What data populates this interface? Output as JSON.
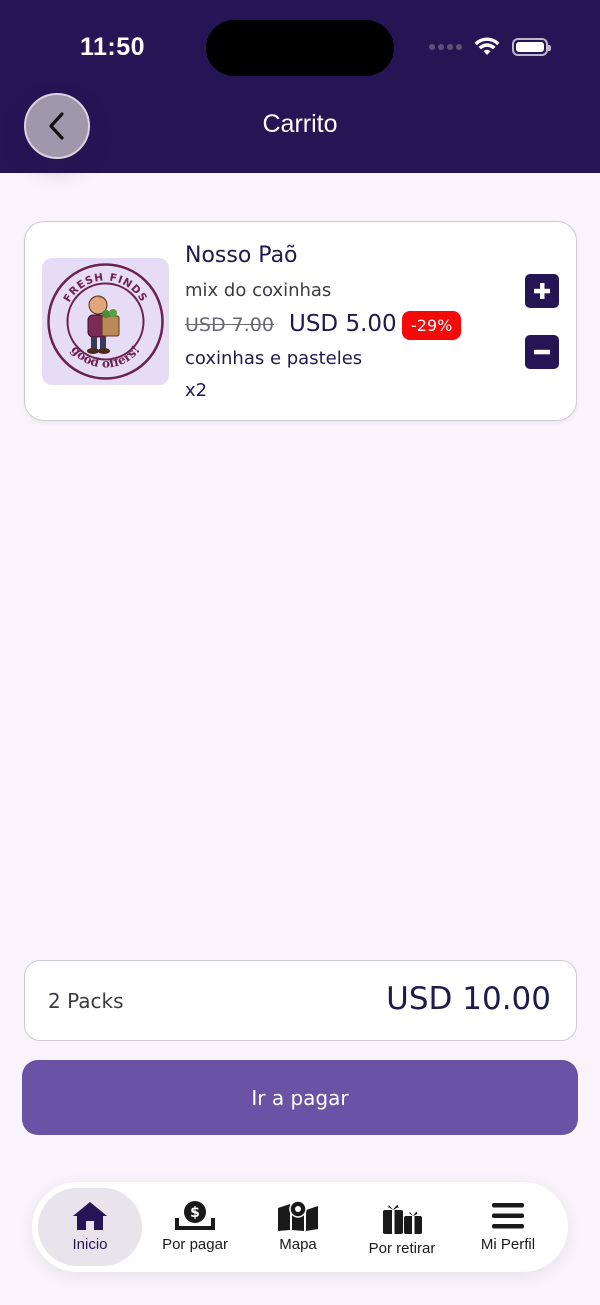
{
  "status_bar": {
    "time": "11:50"
  },
  "header": {
    "title": "Carrito"
  },
  "cart": {
    "items": [
      {
        "name": "Nosso Paõ",
        "subtitle": "mix do coxinhas",
        "old_price": "USD 7.00",
        "new_price": "USD 5.00",
        "discount": "-29%",
        "description": "coxinhas e pasteles",
        "quantity": "x2",
        "logo_text": [
          "FRESH FINDS",
          "good offers!"
        ]
      }
    ]
  },
  "summary": {
    "packs": "2 Packs",
    "total": "USD 10.00"
  },
  "checkout": {
    "label": "Ir a pagar"
  },
  "nav": {
    "items": [
      {
        "label": "Inicio",
        "icon": "home-icon",
        "active": true
      },
      {
        "label": "Por pagar",
        "icon": "money-tray-icon",
        "active": false
      },
      {
        "label": "Mapa",
        "icon": "map-icon",
        "active": false
      },
      {
        "label": "Por retirar",
        "icon": "gift-icon",
        "active": false
      },
      {
        "label": "Mi Perfil",
        "icon": "menu-icon",
        "active": false
      }
    ]
  },
  "colors": {
    "header_bg": "#241654",
    "accent": "#6a52a5",
    "discount_badge": "#f50a0a",
    "page_bg": "#f9f4fb"
  }
}
